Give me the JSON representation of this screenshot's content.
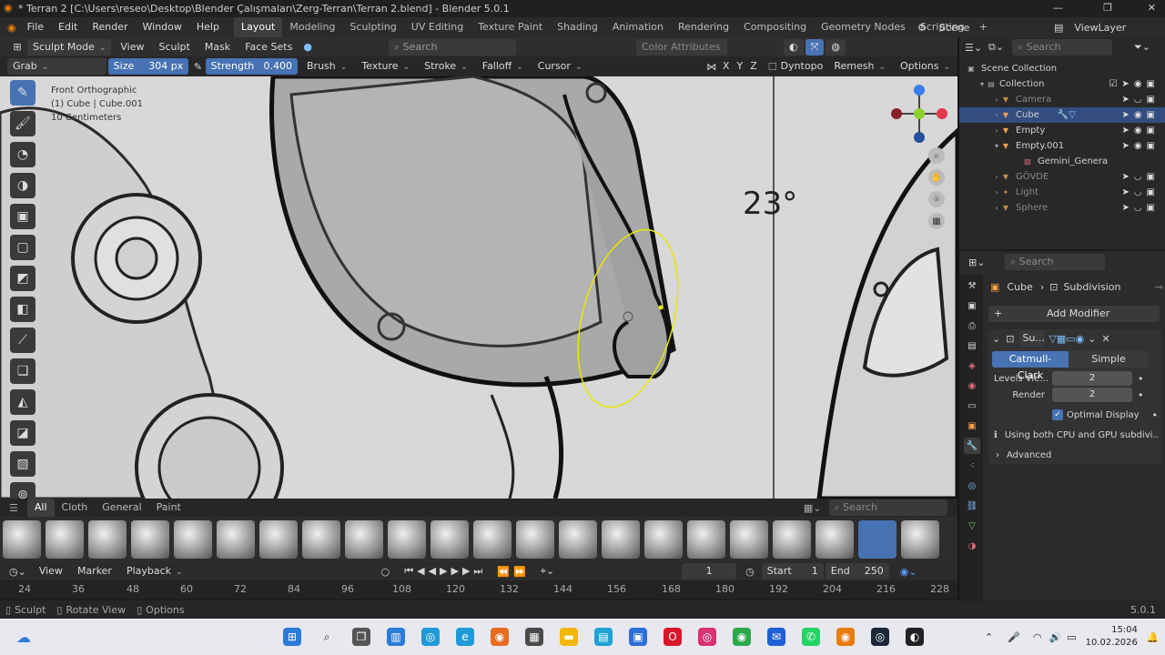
{
  "window": {
    "title": "* Terran 2 [C:\\Users\\reseo\\Desktop\\Blender Çalışmaları\\Zerg-Terran\\Terran 2.blend] - Blender 5.0.1"
  },
  "menu": [
    "File",
    "Edit",
    "Render",
    "Window",
    "Help"
  ],
  "workspaces": [
    "Layout",
    "Modeling",
    "Sculpting",
    "UV Editing",
    "Texture Paint",
    "Shading",
    "Animation",
    "Rendering",
    "Compositing",
    "Geometry Nodes",
    "Scripting"
  ],
  "scene": "Scene",
  "viewlayer": "ViewLayer",
  "header": {
    "mode": "Sculpt Mode",
    "view": "View",
    "sculpt": "Sculpt",
    "mask": "Mask",
    "face_sets": "Face Sets",
    "search_placeholder": "Search",
    "color_attributes": "Color Attributes"
  },
  "tool_settings": {
    "tool": "Grab",
    "size_label": "Size",
    "size_value": "304 px",
    "strength_label": "Strength",
    "strength_value": "0.400",
    "brush": "Brush",
    "texture": "Texture",
    "stroke": "Stroke",
    "falloff": "Falloff",
    "cursor": "Cursor",
    "x": "X",
    "y": "Y",
    "z": "Z",
    "dyntopo": "Dyntopo",
    "remesh": "Remesh",
    "options": "Options"
  },
  "viewport": {
    "view_name": "Front Orthographic",
    "object": "(1) Cube | Cube.001",
    "scale": "10 Centimeters",
    "drawing_label": "23°"
  },
  "asset_bar": {
    "tabs": [
      "All",
      "Cloth",
      "General",
      "Paint"
    ],
    "search_placeholder": "Search"
  },
  "timeline": {
    "view": "View",
    "marker": "Marker",
    "playback": "Playback",
    "current_frame": "1",
    "start_label": "Start",
    "start": "1",
    "end_label": "End",
    "end": "250"
  },
  "ruler": [
    "24",
    "36",
    "48",
    "60",
    "72",
    "84",
    "96",
    "108",
    "120",
    "132",
    "144",
    "156",
    "168",
    "180",
    "192",
    "204",
    "216",
    "228"
  ],
  "status": {
    "sculpt": "Sculpt",
    "rotate": "Rotate View",
    "options": "Options",
    "version": "5.0.1"
  },
  "outliner": {
    "search_placeholder": "Search",
    "scene_collection": "Scene Collection",
    "collection": "Collection",
    "items": [
      {
        "name": "Camera",
        "dim": true
      },
      {
        "name": "Cube",
        "dim": false,
        "selected": true
      },
      {
        "name": "Empty",
        "dim": false
      },
      {
        "name": "Empty.001",
        "dim": false
      },
      {
        "name": "Gemini_Genera",
        "dim": false,
        "child": true
      },
      {
        "name": "GÖVDE",
        "dim": true
      },
      {
        "name": "Light",
        "dim": true
      },
      {
        "name": "Sphere",
        "dim": true
      }
    ]
  },
  "properties": {
    "search_placeholder": "Search",
    "object": "Cube",
    "modifier_crumb": "Subdivision",
    "add_modifier": "Add Modifier",
    "modifier_name": "Su...",
    "catmull": "Catmull-Clark",
    "simple": "Simple",
    "levels_label": "Levels Vie...",
    "levels_value": "2",
    "render_label": "Render",
    "render_value": "2",
    "optimal": "Optimal Display",
    "info": "Using both CPU and GPU subdivi...",
    "advanced": "Advanced"
  },
  "clock": {
    "time": "15:04",
    "date": "10.02.2026"
  }
}
